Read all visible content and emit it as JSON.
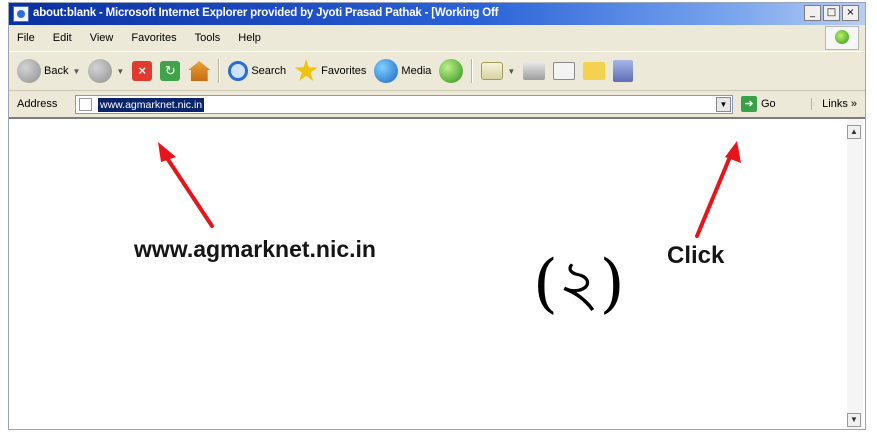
{
  "window": {
    "title": "about:blank - Microsoft Internet Explorer provided by Jyoti Prasad Pathak - [Working Off",
    "controls": {
      "minimize": "_",
      "maximize": "□",
      "close": "×"
    }
  },
  "menu": [
    "File",
    "Edit",
    "View",
    "Favorites",
    "Tools",
    "Help"
  ],
  "toolbar": {
    "back_label": "Back",
    "search_label": "Search",
    "favorites_label": "Favorites",
    "media_label": "Media"
  },
  "address": {
    "label": "Address",
    "url": "www.agmarknet.nic.in",
    "go_label": "Go",
    "links_label": "Links »"
  },
  "annotations": {
    "url_text": "www.agmarknet.nic.in",
    "click_text": "Click",
    "marker": "(২)",
    "arrow_color": "#e8141b"
  }
}
